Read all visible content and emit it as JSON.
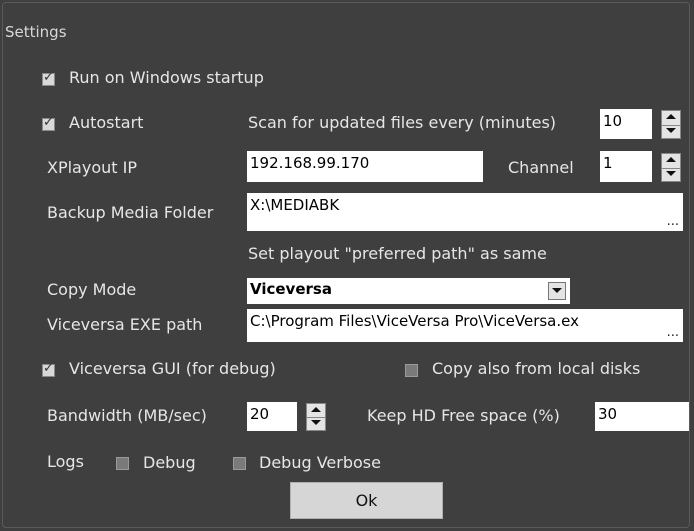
{
  "window": {
    "title": "Settings"
  },
  "run_on_startup": {
    "label": "Run on Windows startup",
    "checked": true
  },
  "autostart": {
    "label": "Autostart",
    "checked": true
  },
  "scan": {
    "label": "Scan for updated files every (minutes)",
    "value": "10"
  },
  "xplayout_ip": {
    "label": "XPlayout IP",
    "value": "192.168.99.170"
  },
  "channel": {
    "label": "Channel",
    "value": "1"
  },
  "backup_folder": {
    "label": "Backup Media Folder",
    "value": "X:\\MEDIABK",
    "browse": "..."
  },
  "preferred_path_note": "Set playout \"preferred path\" as same",
  "copy_mode": {
    "label": "Copy Mode",
    "value": "Viceversa"
  },
  "exe_path": {
    "label": "Viceversa EXE path",
    "value": "C:\\Program Files\\ViceVersa Pro\\ViceVersa.ex",
    "browse": "..."
  },
  "gui_debug": {
    "label": "Viceversa GUI (for debug)",
    "checked": true
  },
  "copy_local": {
    "label": "Copy also from local disks",
    "checked": false
  },
  "bandwidth": {
    "label": "Bandwidth (MB/sec)",
    "value": "20"
  },
  "hd_free": {
    "label": "Keep HD Free space (%)",
    "value": "30"
  },
  "logs": {
    "label": "Logs",
    "debug": {
      "label": "Debug",
      "checked": false
    },
    "debug_verbose": {
      "label": "Debug Verbose",
      "checked": false
    }
  },
  "ok_button": {
    "label": "Ok"
  },
  "icons": [
    "checkbox-checked-icon",
    "checkbox-unchecked-icon",
    "spin-up-arrow-icon",
    "spin-down-arrow-icon",
    "dropdown-arrow-icon",
    "ellipsis-icon"
  ]
}
